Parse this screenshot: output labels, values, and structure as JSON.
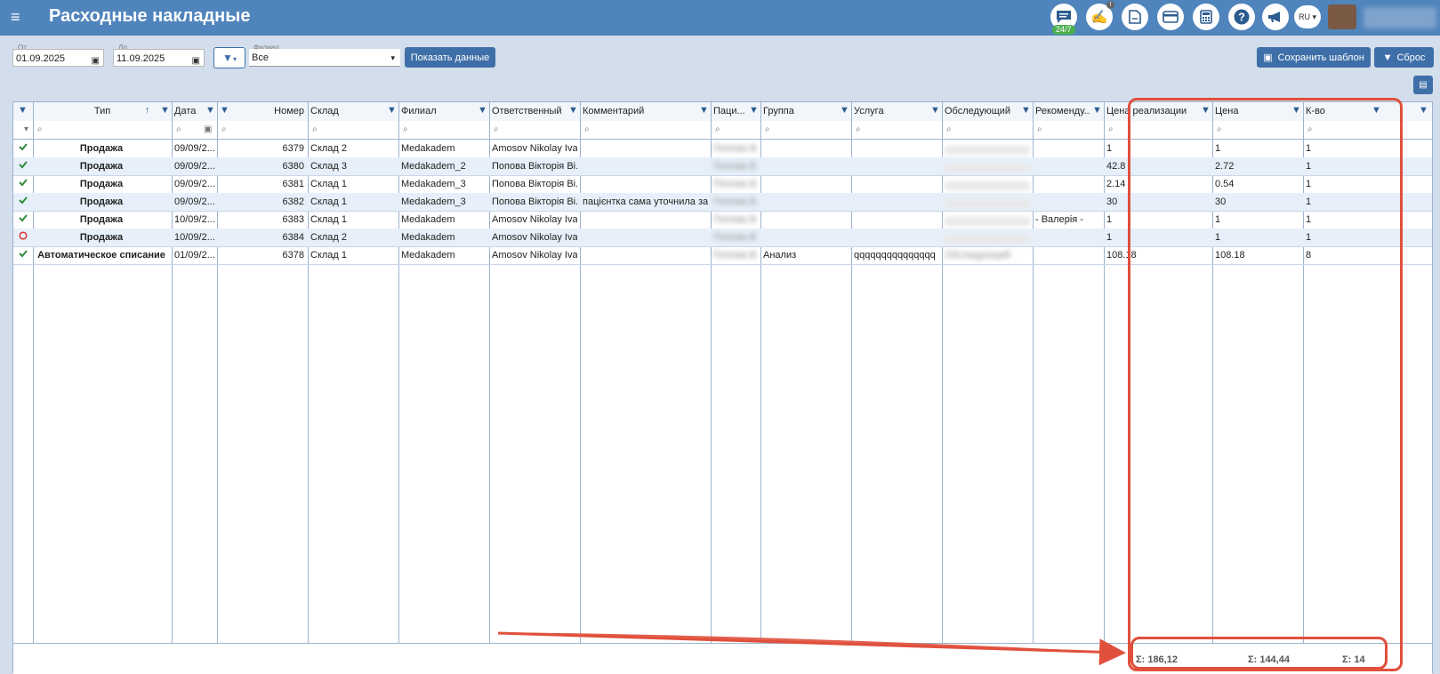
{
  "header": {
    "title": "Расходные накладные",
    "chat_badge": "24/7",
    "lang": "RU",
    "notif_badge": "!"
  },
  "filters": {
    "from_label": "От",
    "from_value": "01.09.2025",
    "to_label": "До",
    "to_value": "11.09.2025",
    "branch_label": "Филиал",
    "branch_value": "Все",
    "show_button": "Показать данные"
  },
  "actions": {
    "save_template": "Сохранить шаблон",
    "reset": "Сброс"
  },
  "columns": [
    "Тип",
    "Дата",
    "Номер",
    "Склад",
    "Филиал",
    "Ответственный",
    "Комментарий",
    "Паци...",
    "Группа",
    "Услуга",
    "Обследующий",
    "Рекоменду...",
    "Цена реализации",
    "Цена",
    "К-во"
  ],
  "rows": [
    {
      "status": "check",
      "type": "Продажа",
      "date": "09/09/2...",
      "number": "6379",
      "warehouse": "Склад 2",
      "branch": "Medakadem",
      "responsible": "Amosov Nikolay Iva...",
      "comment": "",
      "patient": "Попова В.",
      "group": "",
      "service": "",
      "examiner": "",
      "recommender": "",
      "sale_price": "1",
      "price": "1",
      "qty": "1"
    },
    {
      "status": "check",
      "type": "Продажа",
      "date": "09/09/2...",
      "number": "6380",
      "warehouse": "Склад 3",
      "branch": "Medakadem_2",
      "responsible": "Попова Вікторія Ві...",
      "comment": "",
      "patient": "Попова В.",
      "group": "",
      "service": "",
      "examiner": "",
      "recommender": "",
      "sale_price": "42.8",
      "price": "2.72",
      "qty": "1"
    },
    {
      "status": "check",
      "type": "Продажа",
      "date": "09/09/2...",
      "number": "6381",
      "warehouse": "Склад 1",
      "branch": "Medakadem_3",
      "responsible": "Попова Вікторія Ві...",
      "comment": "",
      "patient": "Попова В.",
      "group": "",
      "service": "",
      "examiner": "",
      "recommender": "",
      "sale_price": "2.14",
      "price": "0.54",
      "qty": "1"
    },
    {
      "status": "check",
      "type": "Продажа",
      "date": "09/09/2...",
      "number": "6382",
      "warehouse": "Склад 1",
      "branch": "Medakadem_3",
      "responsible": "Попова Вікторія Ві...",
      "comment": "пацієнтка сама уточнила за ...",
      "patient": "Попова В.",
      "group": "",
      "service": "",
      "examiner": "",
      "recommender": "",
      "sale_price": "30",
      "price": "30",
      "qty": "1"
    },
    {
      "status": "check",
      "type": "Продажа",
      "date": "10/09/2...",
      "number": "6383",
      "warehouse": "Склад 1",
      "branch": "Medakadem",
      "responsible": "Amosov Nikolay Iva...",
      "comment": "",
      "patient": "Попова В.",
      "group": "",
      "service": "",
      "examiner": "",
      "recommender": "- Валерія -",
      "sale_price": "1",
      "price": "1",
      "qty": "1"
    },
    {
      "status": "circle",
      "type": "Продажа",
      "date": "10/09/2...",
      "number": "6384",
      "warehouse": "Склад 2",
      "branch": "Medakadem",
      "responsible": "Amosov Nikolay Iva...",
      "comment": "",
      "patient": "Попова В.",
      "group": "",
      "service": "",
      "examiner": "",
      "recommender": "",
      "sale_price": "1",
      "price": "1",
      "qty": "1"
    },
    {
      "status": "check",
      "type": "Автоматическое списание",
      "date": "01/09/2...",
      "number": "6378",
      "warehouse": "Склад 1",
      "branch": "Medakadem",
      "responsible": "Amosov Nikolay Iva...",
      "comment": "",
      "patient": "Попова В.",
      "group": "Анализ",
      "service": "qqqqqqqqqqqqqqq",
      "examiner": "Обследующий",
      "recommender": "",
      "sale_price": "108.18",
      "price": "108.18",
      "qty": "8"
    }
  ],
  "totals": {
    "sale_price": "Σ: 186,12",
    "price": "Σ: 144,44",
    "qty": "Σ: 14"
  },
  "colors": {
    "topbar": "#5084bc",
    "accent": "#3f6fa8",
    "highlight": "#e0503c",
    "check": "#2e8b3a",
    "circle": "#d9342b"
  }
}
